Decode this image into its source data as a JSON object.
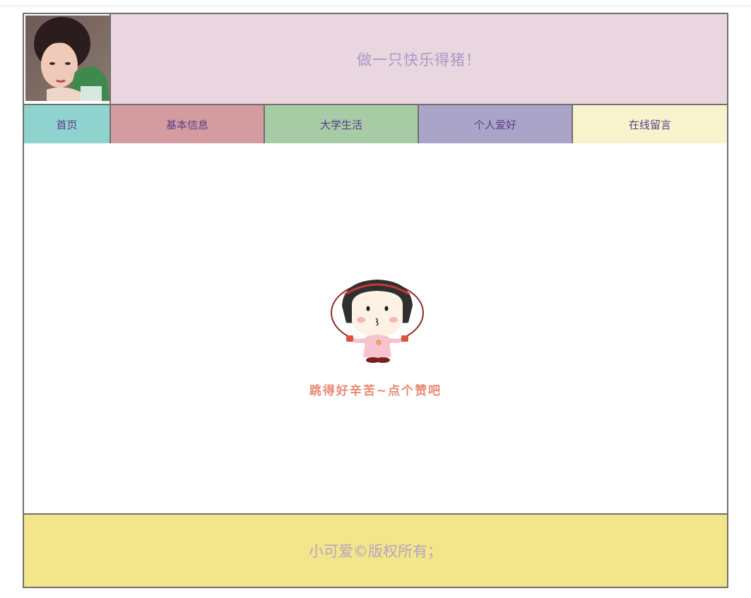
{
  "banner": {
    "title": "做一只快乐得猪！"
  },
  "nav": {
    "items": [
      {
        "label": "首页"
      },
      {
        "label": "基本信息"
      },
      {
        "label": "大学生活"
      },
      {
        "label": "个人爱好"
      },
      {
        "label": "在线留言"
      }
    ]
  },
  "content": {
    "caption": "跳得好辛苦~点个赞吧"
  },
  "footer": {
    "text": "小可爱©版权所有；"
  },
  "colors": {
    "banner_bg": "#e9d6de",
    "nav_home": "#8fd3cf",
    "nav_info": "#d49ca0",
    "nav_college": "#a6cba5",
    "nav_hobby": "#aaa5c8",
    "nav_message": "#f8f2cd",
    "footer_bg": "#f3e58a",
    "border": "#707070"
  }
}
